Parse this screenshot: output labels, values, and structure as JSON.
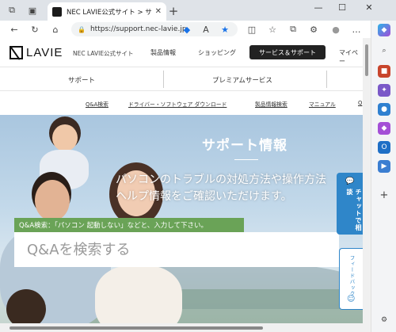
{
  "browser": {
    "tab_title": "NEC LAVIE公式サイト > サービス＆サ",
    "url": "https://support.nec-lavie.jp",
    "icons": {
      "workspaces": "⧉",
      "tab_actions": "▣",
      "close": "✕",
      "new_tab": "+",
      "minimize": "—",
      "maximize": "☐",
      "window_close": "✕",
      "back": "←",
      "reload": "↻",
      "home": "⌂",
      "lock": "🔒",
      "read_aloud": "A",
      "favorite": "★",
      "split": "◫",
      "favorites": "☆",
      "collections": "⧉",
      "extensions": "⚙",
      "profile": "●",
      "more": "…",
      "copilot": "◆",
      "search": "⌕",
      "settings": "⚙",
      "add": "+"
    },
    "star_color": "#1a73e8"
  },
  "site": {
    "logo_text": "LAVIE",
    "site_name": "NEC LAVIE公式サイト",
    "nav": [
      "製品情報",
      "ショッピング",
      "サービス＆サポート",
      "マイペー"
    ],
    "subnav": [
      "サポート",
      "プレミアムサービス"
    ],
    "quick_links": [
      "Q&A検索",
      "ドライバー・ソフトウェア ダウンロード",
      "製品情報検索",
      "マニュアル",
      "Q"
    ]
  },
  "hero": {
    "title": "サポート情報",
    "sub_line1": "パソコンのトラブルの対処方法や操作方法",
    "sub_line2": "ヘルプ情報をご確認いただけます。",
    "search_hint": "Q&A検索：「パソコン 起動しない」などと、入力して下さい。",
    "search_placeholder": "Q&Aを検索する",
    "hint_color": "#6aa357"
  },
  "float": {
    "chat_label": "チャットで相談",
    "feedback_label": "フィードバック",
    "chat_color": "#2f86c9"
  }
}
